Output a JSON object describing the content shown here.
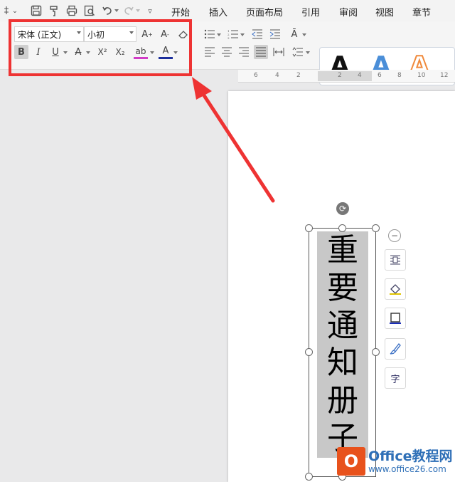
{
  "quick_access": {
    "icons": [
      "save-icon",
      "format-painter-icon",
      "print-icon",
      "print-preview-icon",
      "undo-icon",
      "redo-icon",
      "customize-icon"
    ]
  },
  "menu": {
    "tabs": [
      "开始",
      "插入",
      "页面布局",
      "引用",
      "审阅",
      "视图",
      "章节"
    ]
  },
  "ribbon": {
    "font_name": "宋体 (正文)",
    "font_size": "小初",
    "bold_label": "B",
    "italic_label": "I",
    "underline_label": "U",
    "strike_label": "A",
    "superscript_label": "X²",
    "subscript_label": "X₂",
    "highlight_label": "ab",
    "font_color_label": "A",
    "style_samples": [
      "A",
      "A",
      "A"
    ]
  },
  "colors": {
    "highlight_box": "#ee3333",
    "arrow": "#ee3333",
    "style_black": "#111111",
    "style_blue": "#4a8ed8",
    "style_orange": "#f08a3c"
  },
  "ruler": {
    "ticks": [
      "6",
      "4",
      "2",
      "2",
      "4",
      "6",
      "8",
      "10",
      "12"
    ]
  },
  "document": {
    "vertical_text": [
      "重",
      "要",
      "通",
      "知",
      "册",
      "子"
    ]
  },
  "watermark": {
    "logo": "O",
    "title": "Office教程网",
    "url": "www.office26.com"
  }
}
